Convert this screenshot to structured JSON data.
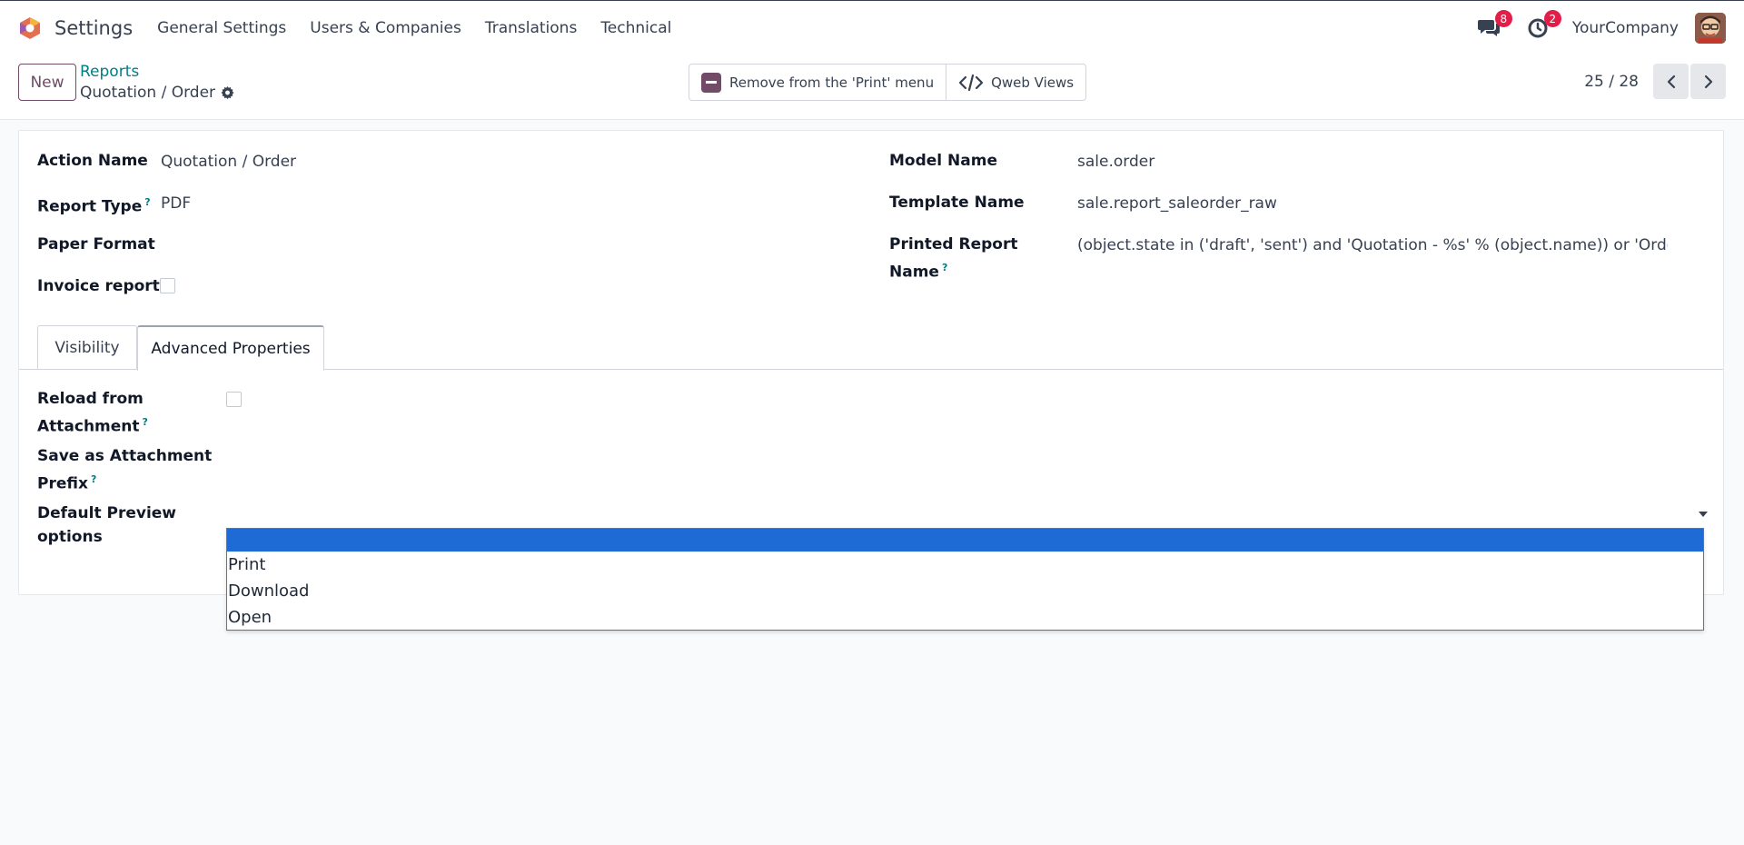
{
  "navbar": {
    "app_title": "Settings",
    "menu": [
      "General Settings",
      "Users & Companies",
      "Translations",
      "Technical"
    ],
    "messages_badge": "8",
    "activities_badge": "2",
    "company": "YourCompany"
  },
  "control_panel": {
    "new_label": "New",
    "breadcrumb_parent": "Reports",
    "breadcrumb_current": "Quotation / Order",
    "remove_label": "Remove from the 'Print' menu",
    "qweb_label": "Qweb Views",
    "pager": "25 / 28"
  },
  "form": {
    "action_name_label": "Action Name",
    "action_name_value": "Quotation / Order",
    "report_type_label": "Report Type",
    "report_type_value": "PDF",
    "paper_format_label": "Paper Format",
    "invoice_report_label": "Invoice report",
    "model_name_label": "Model Name",
    "model_name_value": "sale.order",
    "template_name_label": "Template Name",
    "template_name_value": "sale.report_saleorder_raw",
    "printed_name_label_1": "Printed Report",
    "printed_name_label_2": "Name",
    "printed_name_value": "(object.state in ('draft', 'sent') and 'Quotation - %s' % (object.name)) or 'Order - %s' % (object.name)",
    "help_mark": "?"
  },
  "tabs": [
    "Visibility",
    "Advanced Properties"
  ],
  "advanced": {
    "reload_label_1": "Reload from",
    "reload_label_2": "Attachment",
    "save_prefix_label_1": "Save as Attachment",
    "save_prefix_label_2": "Prefix",
    "preview_label_1": "Default Preview",
    "preview_label_2": "options"
  },
  "dropdown": {
    "options": [
      "",
      "Print",
      "Download",
      "Open"
    ],
    "selected_index": 0
  },
  "colors": {
    "brand": "#714b67",
    "link": "#017e84",
    "badge": "#e11d48",
    "selection": "#1e6bd6"
  }
}
